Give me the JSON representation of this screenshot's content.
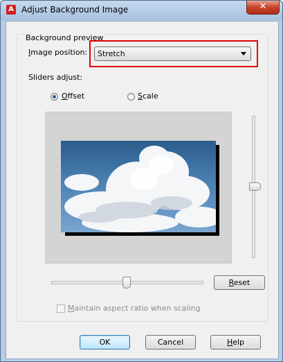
{
  "window": {
    "title": "Adjust Background Image",
    "close_glyph": "✕"
  },
  "group": {
    "label": "Background preview"
  },
  "image_position": {
    "label_prefix": "",
    "label_hotkey": "I",
    "label_rest": "mage position:",
    "selected": "Stretch"
  },
  "sliders_adjust": {
    "label": "Sliders adjust:"
  },
  "radio_offset": {
    "hotkey": "O",
    "rest": "ffset",
    "checked": true
  },
  "radio_scale": {
    "hotkey": "S",
    "rest": "cale",
    "checked": false
  },
  "reset_button": {
    "hotkey": "R",
    "rest": "eset"
  },
  "maintain_aspect": {
    "hotkey": "M",
    "rest": "aintain aspect ratio when scaling",
    "checked": false,
    "enabled": false
  },
  "ok_button": {
    "label": "OK"
  },
  "cancel_button": {
    "label": "Cancel"
  },
  "help_button": {
    "hotkey": "H",
    "rest": "elp"
  },
  "sliders": {
    "vertical_value": 0.5,
    "horizontal_value": 0.5
  }
}
